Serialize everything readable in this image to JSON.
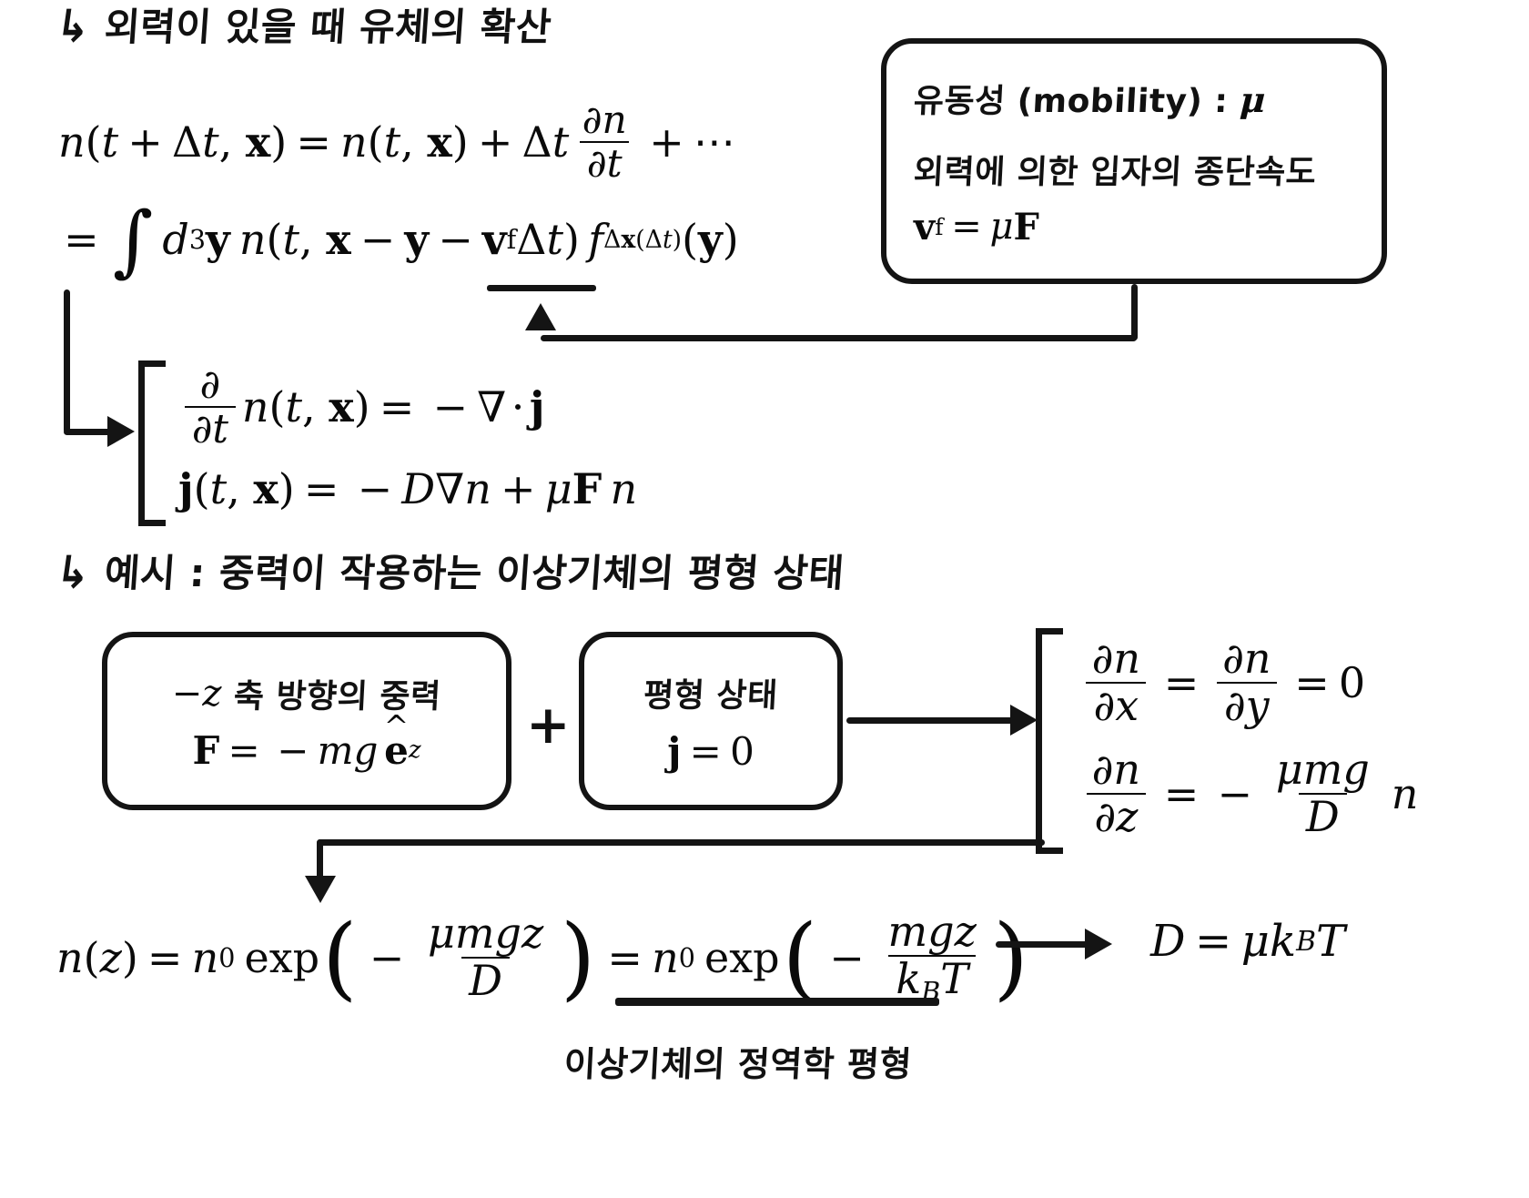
{
  "document": {
    "title": "외력이 있을 때 유체의 확산",
    "language": "ko",
    "ink_color": "#141414",
    "background_color": "#ffffff"
  },
  "section1": {
    "bullet": "↳",
    "heading": "외력이 있을 때 유체의 확산",
    "eq_taylor": {
      "lhs": "n(t + Δt, x)",
      "rhs": "n(t, x) + Δt ∂n/∂t + ⋯",
      "parts": {
        "n": "n",
        "t": "t",
        "delta": "Δ",
        "x": "x",
        "equals": "=",
        "plus": "+",
        "dn": "∂n",
        "dt": "∂t",
        "dots": "⋯"
      }
    },
    "eq_integral": {
      "equals": "=",
      "integral": "∫",
      "measure_d": "d",
      "measure_exp": "3",
      "measure_y": "y",
      "n": "n",
      "open": "(",
      "t": "t",
      "comma": ",",
      "x": "x",
      "minus": "−",
      "y": "y",
      "v": "v",
      "v_sub": "f",
      "deltat": "Δt",
      "close": ")",
      "f": "f",
      "f_sub": "Δx(Δt)",
      "arg_y": "(y)"
    },
    "eq_continuity": {
      "num": "∂",
      "den": "∂t",
      "n_of": "n(t, x)",
      "equals": "=",
      "rhs": "−∇ · j"
    },
    "eq_current": {
      "lhs": "j(t, x)",
      "equals": "=",
      "rhs": "−D∇n + μF n"
    }
  },
  "mobility_box": {
    "line1": "유동성 (mobility) : μ",
    "line1_label": "유동성 (mobility) :",
    "line1_symbol": "μ",
    "line2": "외력에 의한 입자의 종단속도",
    "line3_lhs": "v",
    "line3_sub": "f",
    "line3_equals": "=",
    "line3_rhs": "μF"
  },
  "section2": {
    "bullet": "↳",
    "heading": "예시 : 중력이 작용하는 이상기체의 평형 상태",
    "gravity_box": {
      "line1_prefix": "−z",
      "line1_text": "축 방향의 중력",
      "line2_lhs": "F",
      "line2_equals": "=",
      "line2_rhs": "−mg ê",
      "line2_sub": "z"
    },
    "plus": "+",
    "equilibrium_box": {
      "line1": "평형 상태",
      "line2_lhs": "j",
      "line2_equals": "=",
      "line2_rhs": "0"
    },
    "results": {
      "eq1": {
        "num1": "∂n",
        "den1": "∂x",
        "eq_a": "=",
        "num2": "∂n",
        "den2": "∂y",
        "eq_b": "=",
        "value": "0"
      },
      "eq2": {
        "num1": "∂n",
        "den1": "∂z",
        "equals": "=",
        "minus": "−",
        "num2": "μmg",
        "den2": "D",
        "tail": "n"
      }
    },
    "final": {
      "lhs": "n(z)",
      "equals1": "=",
      "n0_a": "n",
      "n0_sub_a": "0",
      "exp_a": "exp",
      "arg_a_minus": "−",
      "arg_a_num": "μmgz",
      "arg_a_den": "D",
      "equals2": "=",
      "n0_b": "n",
      "n0_sub_b": "0",
      "exp_b": "exp",
      "arg_b_minus": "−",
      "arg_b_num": "mgz",
      "arg_b_den_k": "k",
      "arg_b_den_sub": "B",
      "arg_b_den_T": "T"
    },
    "caption": "이상기체의 정역학 평형",
    "einstein_relation": {
      "lhs": "D",
      "equals": "=",
      "rhs_mu": "μ",
      "rhs_k": "k",
      "rhs_k_sub": "B",
      "rhs_T": "T"
    }
  },
  "annotations": {
    "arrow_from_mobility_box_to_vf": "up-left elbow arrow",
    "arrow_from_integral_to_continuity": "down-right elbow arrow",
    "arrow_from_boxes_to_results": "right arrow",
    "arrow_from_results_to_final": "left-down elbow arrow",
    "arrow_to_einstein": "right arrow"
  }
}
